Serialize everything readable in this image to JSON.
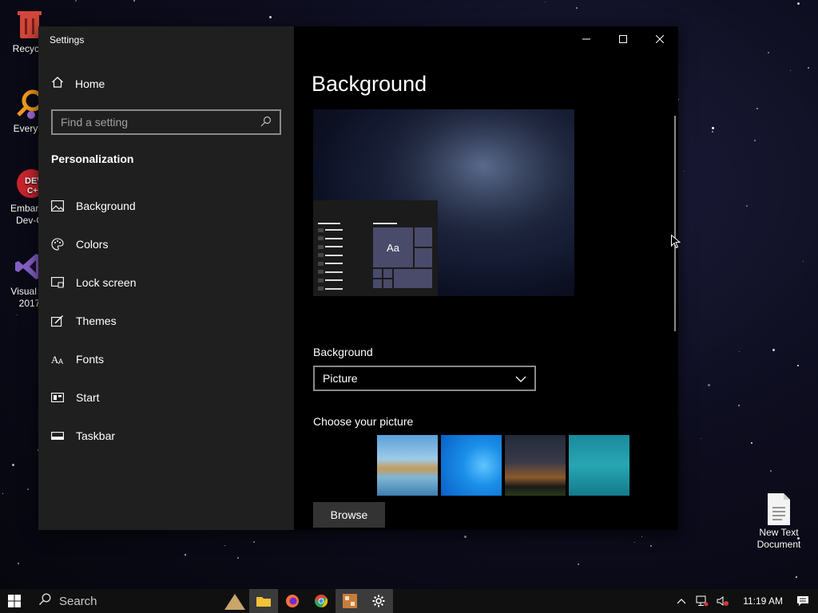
{
  "desktop": {
    "icons": [
      {
        "label": "Recycle"
      },
      {
        "label": "Everyth"
      },
      {
        "label": "Embarca Dev-C"
      },
      {
        "label": "Visual St 2017"
      },
      {
        "label": "New Text Document"
      }
    ]
  },
  "window": {
    "title": "Settings",
    "nav": {
      "home_label": "Home",
      "search_placeholder": "Find a setting",
      "section_title": "Personalization",
      "items": [
        {
          "label": "Background",
          "icon": "picture-icon"
        },
        {
          "label": "Colors",
          "icon": "palette-icon"
        },
        {
          "label": "Lock screen",
          "icon": "lock-screen-icon"
        },
        {
          "label": "Themes",
          "icon": "themes-icon"
        },
        {
          "label": "Fonts",
          "icon": "fonts-icon"
        },
        {
          "label": "Start",
          "icon": "start-icon"
        },
        {
          "label": "Taskbar",
          "icon": "taskbar-icon"
        }
      ]
    },
    "content": {
      "page_title": "Background",
      "preview_tile_text": "Aa",
      "background_label": "Background",
      "background_value": "Picture",
      "choose_label": "Choose your picture",
      "browse_label": "Browse"
    }
  },
  "taskbar": {
    "search_label": "Search",
    "clock": "11:19 AM"
  }
}
